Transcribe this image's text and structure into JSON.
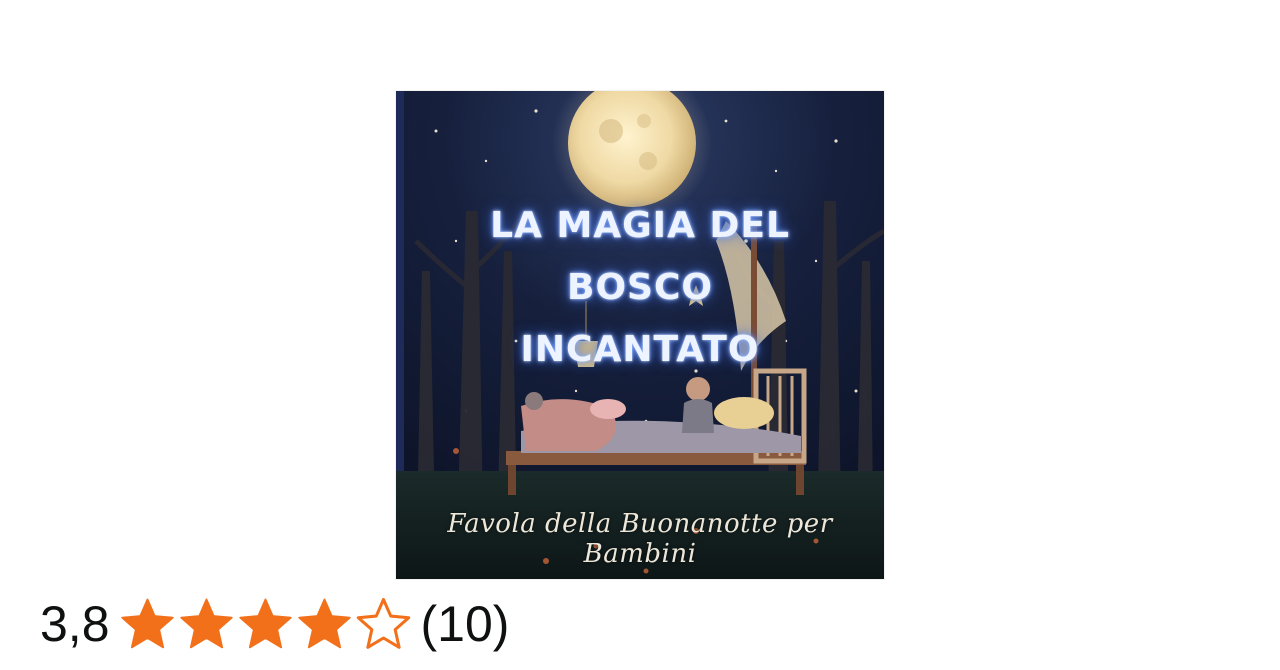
{
  "cover": {
    "title": "LA MAGIA DEL\nBOSCO\nINCANTATO",
    "subtitle": "Favola della Buonanotte per Bambini"
  },
  "rating": {
    "value_text": "3,8",
    "value": 3.8,
    "stars_total": 5,
    "stars_filled": 4,
    "count_text": "(10)",
    "star_color": "#f3701b"
  }
}
